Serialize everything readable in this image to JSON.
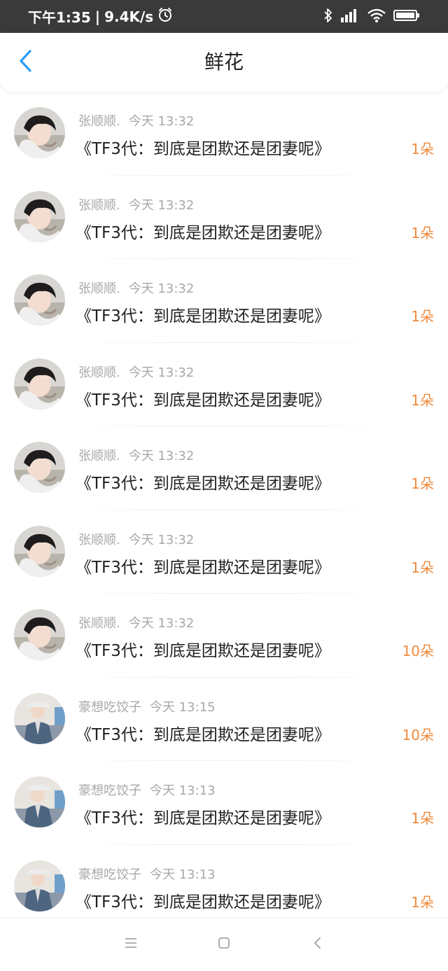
{
  "status_bar": {
    "time": "下午1:35",
    "separator": "|",
    "speed": "9.4K/s",
    "icons": [
      "alarm-icon",
      "bluetooth-icon",
      "signal-icon",
      "wifi-icon",
      "battery-icon"
    ]
  },
  "header": {
    "title": "鲜花",
    "back_icon": "chevron-left-icon",
    "accent_color": "#2b9cf2"
  },
  "colors": {
    "count": "#f08a3c",
    "meta": "#a8a8a8",
    "text": "#222222",
    "status_bar_bg": "#3a3a3a"
  },
  "items": [
    {
      "user": "张顺顺.",
      "time": "今天 13:32",
      "message": "《TF3代：到底是团欺还是团妻呢》",
      "count": "1朵",
      "avatar": "avatar-a"
    },
    {
      "user": "张顺顺.",
      "time": "今天 13:32",
      "message": "《TF3代：到底是团欺还是团妻呢》",
      "count": "1朵",
      "avatar": "avatar-a"
    },
    {
      "user": "张顺顺.",
      "time": "今天 13:32",
      "message": "《TF3代：到底是团欺还是团妻呢》",
      "count": "1朵",
      "avatar": "avatar-a"
    },
    {
      "user": "张顺顺.",
      "time": "今天 13:32",
      "message": "《TF3代：到底是团欺还是团妻呢》",
      "count": "1朵",
      "avatar": "avatar-a"
    },
    {
      "user": "张顺顺.",
      "time": "今天 13:32",
      "message": "《TF3代：到底是团欺还是团妻呢》",
      "count": "1朵",
      "avatar": "avatar-a"
    },
    {
      "user": "张顺顺.",
      "time": "今天 13:32",
      "message": "《TF3代：到底是团欺还是团妻呢》",
      "count": "1朵",
      "avatar": "avatar-a"
    },
    {
      "user": "张顺顺.",
      "time": "今天 13:32",
      "message": "《TF3代：到底是团欺还是团妻呢》",
      "count": "10朵",
      "avatar": "avatar-a"
    },
    {
      "user": "豪想吃饺子",
      "time": "今天 13:15",
      "message": "《TF3代：到底是团欺还是团妻呢》",
      "count": "10朵",
      "avatar": "avatar-b"
    },
    {
      "user": "豪想吃饺子",
      "time": "今天 13:13",
      "message": "《TF3代：到底是团欺还是团妻呢》",
      "count": "1朵",
      "avatar": "avatar-b"
    },
    {
      "user": "豪想吃饺子",
      "time": "今天 13:13",
      "message": "《TF3代：到底是团欺还是团妻呢》",
      "count": "1朵",
      "avatar": "avatar-b"
    }
  ],
  "nav_bar": {
    "icons": [
      "menu-icon",
      "home-icon",
      "back-icon"
    ]
  }
}
